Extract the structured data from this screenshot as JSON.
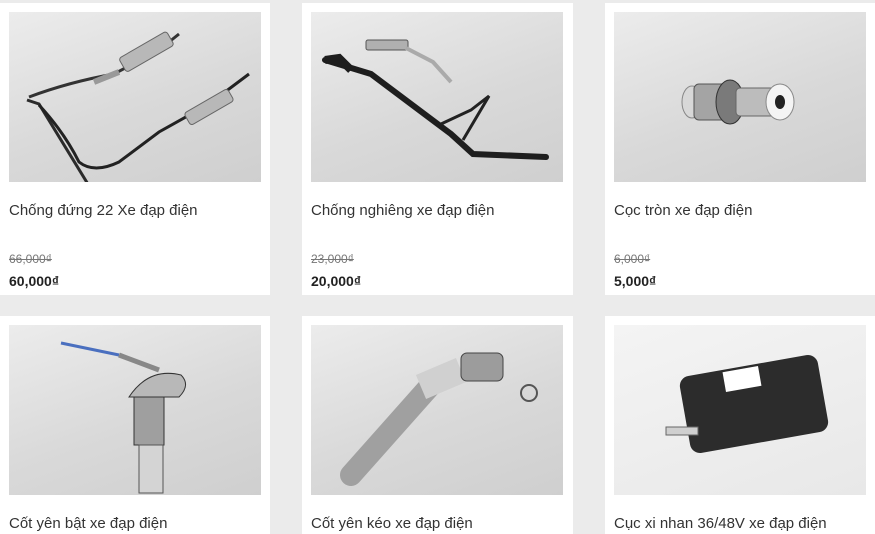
{
  "products": [
    {
      "name": "Chống đứng 22 Xe đạp điện",
      "old_price": "66,000₫",
      "price": "60,000₫",
      "image_icon": "kickstand-double-icon"
    },
    {
      "name": "Chống nghiêng xe đạp điện",
      "old_price": "23,000₫",
      "price": "20,000₫",
      "image_icon": "kickstand-side-icon"
    },
    {
      "name": "Cọc tròn xe đạp điện",
      "old_price": "6,000₫",
      "price": "5,000₫",
      "image_icon": "round-terminal-icon"
    },
    {
      "name": "Cốt yên bật xe đạp điện",
      "image_icon": "seatpost-spring-icon"
    },
    {
      "name": "Cốt yên kéo xe đạp điện",
      "image_icon": "seatpost-lever-icon"
    },
    {
      "name": "Cục xi nhan 36/48V xe đạp điện",
      "image_icon": "turn-signal-relay-icon"
    }
  ],
  "colors": {
    "background": "#ebebeb",
    "card": "#ffffff",
    "text": "#333333",
    "old_price": "#777777"
  }
}
